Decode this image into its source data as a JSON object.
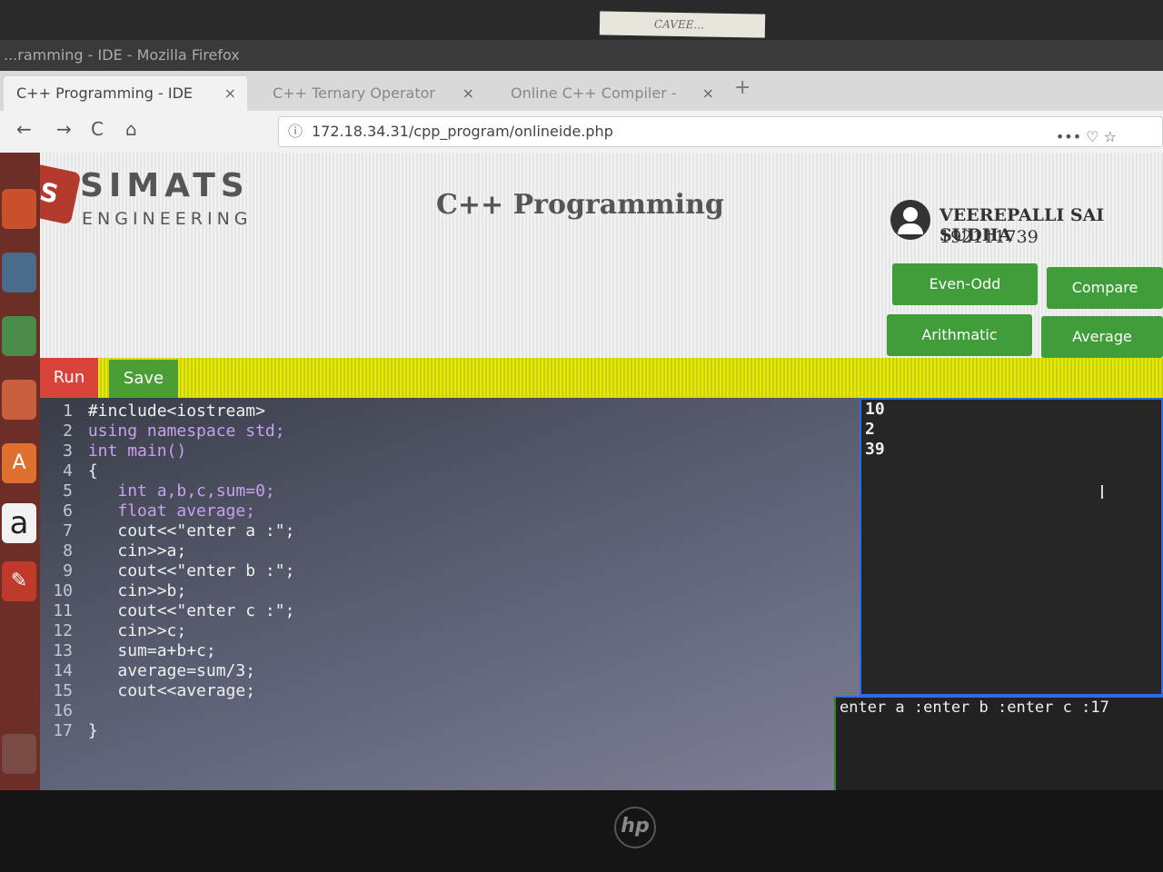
{
  "sticker": {
    "text": "CAVEE..."
  },
  "window": {
    "title": "...ramming - IDE - Mozilla Firefox"
  },
  "tabs": [
    {
      "label": "C++ Programming - IDE",
      "close": "×"
    },
    {
      "label": "C++ Ternary Operator",
      "close": "×"
    },
    {
      "label": "Online C++ Compiler -",
      "close": "×"
    }
  ],
  "nav": {
    "back": "←",
    "forward": "→",
    "reload": "C",
    "home": "⌂",
    "url": "172.18.34.31/cpp_program/onlineide.php",
    "info_icon": "ⓘ",
    "menu_icons": "•••  ♡  ☆",
    "new_tab": "+"
  },
  "launcher": {
    "icons": [
      "",
      "",
      "",
      "",
      "A",
      "a",
      "✎",
      ""
    ]
  },
  "header": {
    "brand_top": "SIMATS",
    "brand_bottom": "ENGINEERING",
    "logo_mark": "S",
    "title": "C++ Programming",
    "user_name": "VEEREPALLI SAI SUDHA",
    "user_id": "192111739"
  },
  "examples": {
    "even_odd": "Even-Odd",
    "compare": "Compare",
    "arithmatic": "Arithmatic",
    "average": "Average"
  },
  "toolbar": {
    "run": "Run",
    "save": "Save"
  },
  "code": [
    {
      "n": "1",
      "text": "#include<iostream>"
    },
    {
      "n": "2",
      "text": "using namespace std;"
    },
    {
      "n": "3",
      "text": "int main()"
    },
    {
      "n": "4",
      "text": "{"
    },
    {
      "n": "5",
      "text": "   int a,b,c,sum=0;"
    },
    {
      "n": "6",
      "text": "   float average;"
    },
    {
      "n": "7",
      "text": "   cout<<\"enter a :\";"
    },
    {
      "n": "8",
      "text": "   cin>>a;"
    },
    {
      "n": "9",
      "text": "   cout<<\"enter b :\";"
    },
    {
      "n": "10",
      "text": "   cin>>b;"
    },
    {
      "n": "11",
      "text": "   cout<<\"enter c :\";"
    },
    {
      "n": "12",
      "text": "   cin>>c;"
    },
    {
      "n": "13",
      "text": "   sum=a+b+c;"
    },
    {
      "n": "14",
      "text": "   average=sum/3;"
    },
    {
      "n": "15",
      "text": "   cout<<average;"
    },
    {
      "n": "16",
      "text": ""
    },
    {
      "n": "17",
      "text": "}"
    }
  ],
  "input": {
    "lines": [
      "10",
      "2",
      "39"
    ]
  },
  "console": {
    "text": "enter a :enter b :enter c :17"
  },
  "bezel": {
    "brand": "hp"
  }
}
